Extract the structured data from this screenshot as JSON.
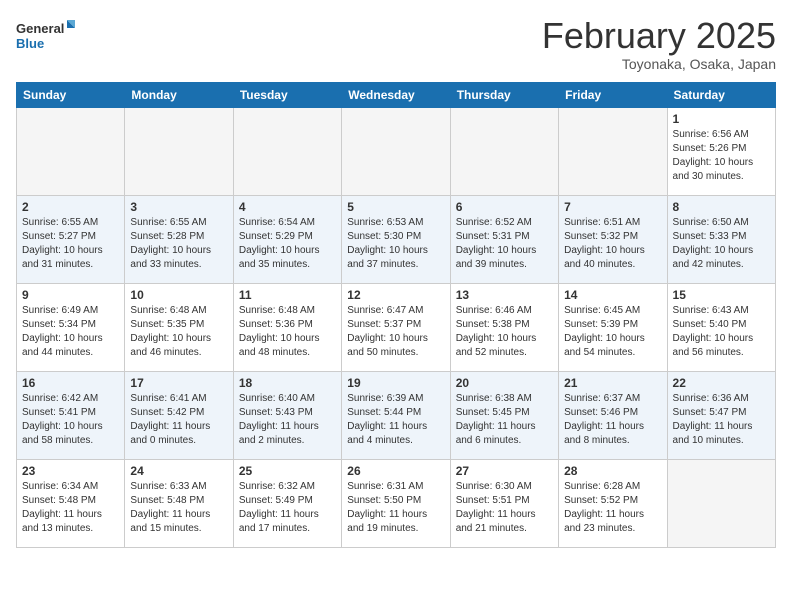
{
  "logo": {
    "line1": "General",
    "line2": "Blue"
  },
  "title": "February 2025",
  "location": "Toyonaka, Osaka, Japan",
  "weekdays": [
    "Sunday",
    "Monday",
    "Tuesday",
    "Wednesday",
    "Thursday",
    "Friday",
    "Saturday"
  ],
  "weeks": [
    [
      {
        "day": "",
        "info": ""
      },
      {
        "day": "",
        "info": ""
      },
      {
        "day": "",
        "info": ""
      },
      {
        "day": "",
        "info": ""
      },
      {
        "day": "",
        "info": ""
      },
      {
        "day": "",
        "info": ""
      },
      {
        "day": "1",
        "info": "Sunrise: 6:56 AM\nSunset: 5:26 PM\nDaylight: 10 hours\nand 30 minutes."
      }
    ],
    [
      {
        "day": "2",
        "info": "Sunrise: 6:55 AM\nSunset: 5:27 PM\nDaylight: 10 hours\nand 31 minutes."
      },
      {
        "day": "3",
        "info": "Sunrise: 6:55 AM\nSunset: 5:28 PM\nDaylight: 10 hours\nand 33 minutes."
      },
      {
        "day": "4",
        "info": "Sunrise: 6:54 AM\nSunset: 5:29 PM\nDaylight: 10 hours\nand 35 minutes."
      },
      {
        "day": "5",
        "info": "Sunrise: 6:53 AM\nSunset: 5:30 PM\nDaylight: 10 hours\nand 37 minutes."
      },
      {
        "day": "6",
        "info": "Sunrise: 6:52 AM\nSunset: 5:31 PM\nDaylight: 10 hours\nand 39 minutes."
      },
      {
        "day": "7",
        "info": "Sunrise: 6:51 AM\nSunset: 5:32 PM\nDaylight: 10 hours\nand 40 minutes."
      },
      {
        "day": "8",
        "info": "Sunrise: 6:50 AM\nSunset: 5:33 PM\nDaylight: 10 hours\nand 42 minutes."
      }
    ],
    [
      {
        "day": "9",
        "info": "Sunrise: 6:49 AM\nSunset: 5:34 PM\nDaylight: 10 hours\nand 44 minutes."
      },
      {
        "day": "10",
        "info": "Sunrise: 6:48 AM\nSunset: 5:35 PM\nDaylight: 10 hours\nand 46 minutes."
      },
      {
        "day": "11",
        "info": "Sunrise: 6:48 AM\nSunset: 5:36 PM\nDaylight: 10 hours\nand 48 minutes."
      },
      {
        "day": "12",
        "info": "Sunrise: 6:47 AM\nSunset: 5:37 PM\nDaylight: 10 hours\nand 50 minutes."
      },
      {
        "day": "13",
        "info": "Sunrise: 6:46 AM\nSunset: 5:38 PM\nDaylight: 10 hours\nand 52 minutes."
      },
      {
        "day": "14",
        "info": "Sunrise: 6:45 AM\nSunset: 5:39 PM\nDaylight: 10 hours\nand 54 minutes."
      },
      {
        "day": "15",
        "info": "Sunrise: 6:43 AM\nSunset: 5:40 PM\nDaylight: 10 hours\nand 56 minutes."
      }
    ],
    [
      {
        "day": "16",
        "info": "Sunrise: 6:42 AM\nSunset: 5:41 PM\nDaylight: 10 hours\nand 58 minutes."
      },
      {
        "day": "17",
        "info": "Sunrise: 6:41 AM\nSunset: 5:42 PM\nDaylight: 11 hours\nand 0 minutes."
      },
      {
        "day": "18",
        "info": "Sunrise: 6:40 AM\nSunset: 5:43 PM\nDaylight: 11 hours\nand 2 minutes."
      },
      {
        "day": "19",
        "info": "Sunrise: 6:39 AM\nSunset: 5:44 PM\nDaylight: 11 hours\nand 4 minutes."
      },
      {
        "day": "20",
        "info": "Sunrise: 6:38 AM\nSunset: 5:45 PM\nDaylight: 11 hours\nand 6 minutes."
      },
      {
        "day": "21",
        "info": "Sunrise: 6:37 AM\nSunset: 5:46 PM\nDaylight: 11 hours\nand 8 minutes."
      },
      {
        "day": "22",
        "info": "Sunrise: 6:36 AM\nSunset: 5:47 PM\nDaylight: 11 hours\nand 10 minutes."
      }
    ],
    [
      {
        "day": "23",
        "info": "Sunrise: 6:34 AM\nSunset: 5:48 PM\nDaylight: 11 hours\nand 13 minutes."
      },
      {
        "day": "24",
        "info": "Sunrise: 6:33 AM\nSunset: 5:48 PM\nDaylight: 11 hours\nand 15 minutes."
      },
      {
        "day": "25",
        "info": "Sunrise: 6:32 AM\nSunset: 5:49 PM\nDaylight: 11 hours\nand 17 minutes."
      },
      {
        "day": "26",
        "info": "Sunrise: 6:31 AM\nSunset: 5:50 PM\nDaylight: 11 hours\nand 19 minutes."
      },
      {
        "day": "27",
        "info": "Sunrise: 6:30 AM\nSunset: 5:51 PM\nDaylight: 11 hours\nand 21 minutes."
      },
      {
        "day": "28",
        "info": "Sunrise: 6:28 AM\nSunset: 5:52 PM\nDaylight: 11 hours\nand 23 minutes."
      },
      {
        "day": "",
        "info": ""
      }
    ]
  ]
}
